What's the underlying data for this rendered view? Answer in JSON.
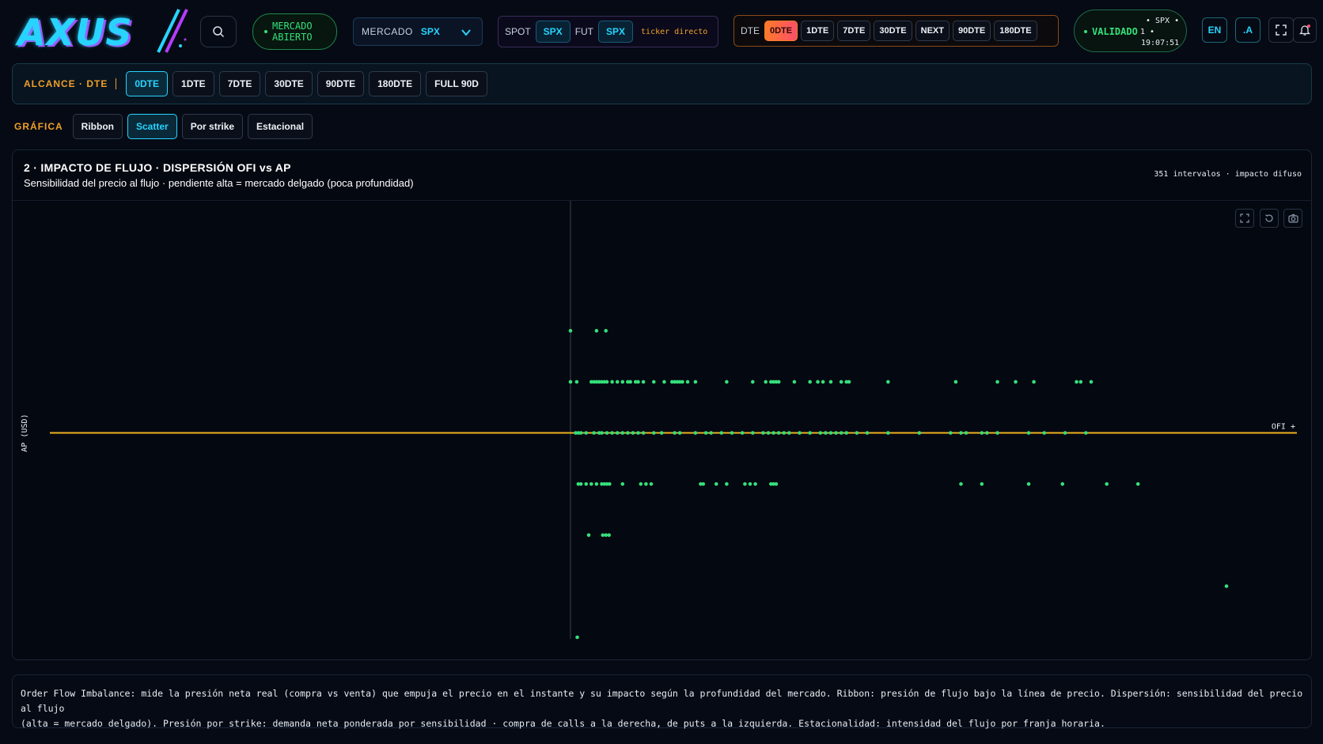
{
  "brand": {
    "name": "AXUS"
  },
  "market_status": {
    "line1": "MERCADO",
    "line2": "ABIERTO"
  },
  "mercado": {
    "label": "MERCADO",
    "value": "SPX"
  },
  "ticker": {
    "spot_label": "SPOT",
    "spot_value": "SPX",
    "fut_label": "FUT",
    "fut_value": "SPX",
    "note": "ticker directo"
  },
  "dte_bar": {
    "label": "DTE",
    "items": [
      "0DTE",
      "1DTE",
      "7DTE",
      "30DTE",
      "NEXT",
      "90DTE",
      "180DTE"
    ],
    "active": "0DTE"
  },
  "validation": {
    "status": "VALIDADO",
    "symbol": "• SPX •",
    "count": "1 •",
    "time": "19:07:51"
  },
  "lang": {
    "label": "EN"
  },
  "font_toggle": {
    "label": ".A"
  },
  "alcance": {
    "label": "ALCANCE · DTE",
    "items": [
      "0DTE",
      "1DTE",
      "7DTE",
      "30DTE",
      "90DTE",
      "180DTE",
      "FULL 90D"
    ],
    "active": "0DTE"
  },
  "grafica": {
    "label": "GRÁFICA",
    "items": [
      "Ribbon",
      "Scatter",
      "Por strike",
      "Estacional"
    ],
    "active": "Scatter"
  },
  "panel": {
    "title": "2 · IMPACTO DE FLUJO · DISPERSIÓN OFI vs AP",
    "subtitle": "Sensibilidad del precio al flujo · pendiente alta = mercado delgado (poca profundidad)",
    "meta": "351 intervalos · impacto difuso"
  },
  "colors": {
    "accent_cyan": "#28d4ff",
    "accent_orange": "#f0a028",
    "positive_green": "#35e07a",
    "zero_line": "#f0b020"
  },
  "chart_data": {
    "type": "scatter",
    "title": "2 · IMPACTO DE FLUJO · DISPERSIÓN OFI vs AP",
    "xlabel": "",
    "ylabel": "AP (USD)",
    "zero_line_label": "OFI +",
    "xlim": [
      -1,
      1
    ],
    "ylim": [
      -4,
      4
    ],
    "grid": false,
    "series": [
      {
        "points": [
          [
            0.0,
            2
          ],
          [
            0.05,
            2
          ],
          [
            0.068,
            2
          ],
          [
            0.0,
            1
          ],
          [
            0.012,
            1
          ],
          [
            0.04,
            1
          ],
          [
            0.045,
            1
          ],
          [
            0.05,
            1
          ],
          [
            0.055,
            1
          ],
          [
            0.06,
            1
          ],
          [
            0.065,
            1
          ],
          [
            0.07,
            1
          ],
          [
            0.08,
            1
          ],
          [
            0.09,
            1
          ],
          [
            0.1,
            1
          ],
          [
            0.11,
            1
          ],
          [
            0.115,
            1
          ],
          [
            0.125,
            1
          ],
          [
            0.13,
            1
          ],
          [
            0.14,
            1
          ],
          [
            0.16,
            1
          ],
          [
            0.18,
            1
          ],
          [
            0.195,
            1
          ],
          [
            0.2,
            1
          ],
          [
            0.205,
            1
          ],
          [
            0.21,
            1
          ],
          [
            0.215,
            1
          ],
          [
            0.225,
            1
          ],
          [
            0.24,
            1
          ],
          [
            0.3,
            1
          ],
          [
            0.35,
            1
          ],
          [
            0.375,
            1
          ],
          [
            0.385,
            1
          ],
          [
            0.39,
            1
          ],
          [
            0.395,
            1
          ],
          [
            0.4,
            1
          ],
          [
            0.43,
            1
          ],
          [
            0.46,
            1
          ],
          [
            0.475,
            1
          ],
          [
            0.485,
            1
          ],
          [
            0.5,
            1
          ],
          [
            0.52,
            1
          ],
          [
            0.53,
            1
          ],
          [
            0.535,
            1
          ],
          [
            0.61,
            1
          ],
          [
            0.74,
            1
          ],
          [
            0.82,
            1
          ],
          [
            0.855,
            1
          ],
          [
            0.89,
            1
          ],
          [
            0.972,
            1
          ],
          [
            0.98,
            1
          ],
          [
            1.0,
            1
          ],
          [
            0.01,
            0
          ],
          [
            0.015,
            0
          ],
          [
            0.02,
            0
          ],
          [
            0.03,
            0
          ],
          [
            0.045,
            0
          ],
          [
            0.055,
            0
          ],
          [
            0.06,
            0
          ],
          [
            0.07,
            0
          ],
          [
            0.08,
            0
          ],
          [
            0.09,
            0
          ],
          [
            0.1,
            0
          ],
          [
            0.11,
            0
          ],
          [
            0.12,
            0
          ],
          [
            0.13,
            0
          ],
          [
            0.14,
            0
          ],
          [
            0.16,
            0
          ],
          [
            0.175,
            0
          ],
          [
            0.2,
            0
          ],
          [
            0.21,
            0
          ],
          [
            0.24,
            0
          ],
          [
            0.26,
            0
          ],
          [
            0.27,
            0
          ],
          [
            0.29,
            0
          ],
          [
            0.31,
            0
          ],
          [
            0.33,
            0
          ],
          [
            0.35,
            0
          ],
          [
            0.37,
            0
          ],
          [
            0.38,
            0
          ],
          [
            0.39,
            0
          ],
          [
            0.4,
            0
          ],
          [
            0.41,
            0
          ],
          [
            0.42,
            0
          ],
          [
            0.44,
            0
          ],
          [
            0.46,
            0
          ],
          [
            0.48,
            0
          ],
          [
            0.49,
            0
          ],
          [
            0.5,
            0
          ],
          [
            0.51,
            0
          ],
          [
            0.52,
            0
          ],
          [
            0.53,
            0
          ],
          [
            0.55,
            0
          ],
          [
            0.57,
            0
          ],
          [
            0.61,
            0
          ],
          [
            0.67,
            0
          ],
          [
            0.73,
            0
          ],
          [
            0.75,
            0
          ],
          [
            0.76,
            0
          ],
          [
            0.79,
            0
          ],
          [
            0.8,
            0
          ],
          [
            0.82,
            0
          ],
          [
            0.88,
            0
          ],
          [
            0.91,
            0
          ],
          [
            0.95,
            0
          ],
          [
            0.99,
            0
          ],
          [
            0.015,
            -1
          ],
          [
            0.02,
            -1
          ],
          [
            0.03,
            -1
          ],
          [
            0.04,
            -1
          ],
          [
            0.05,
            -1
          ],
          [
            0.06,
            -1
          ],
          [
            0.065,
            -1
          ],
          [
            0.07,
            -1
          ],
          [
            0.075,
            -1
          ],
          [
            0.1,
            -1
          ],
          [
            0.135,
            -1
          ],
          [
            0.145,
            -1
          ],
          [
            0.155,
            -1
          ],
          [
            0.25,
            -1
          ],
          [
            0.255,
            -1
          ],
          [
            0.28,
            -1
          ],
          [
            0.3,
            -1
          ],
          [
            0.335,
            -1
          ],
          [
            0.345,
            -1
          ],
          [
            0.355,
            -1
          ],
          [
            0.385,
            -1
          ],
          [
            0.39,
            -1
          ],
          [
            0.395,
            -1
          ],
          [
            0.75,
            -1
          ],
          [
            0.79,
            -1
          ],
          [
            0.88,
            -1
          ],
          [
            0.945,
            -1
          ],
          [
            1.03,
            -1
          ],
          [
            1.09,
            -1
          ],
          [
            0.035,
            -2
          ],
          [
            0.062,
            -2
          ],
          [
            0.068,
            -2
          ],
          [
            0.074,
            -2
          ],
          [
            1.26,
            -3
          ],
          [
            0.013,
            -4
          ]
        ]
      }
    ]
  },
  "footer": {
    "line1": "Order Flow Imbalance: mide la presión neta real (compra vs venta) que empuja el precio en el instante y su impacto según la profundidad del mercado. Ribbon: presión de flujo bajo la línea de precio. Dispersión: sensibilidad del precio al flujo",
    "line2": "(alta = mercado delgado). Presión por strike: demanda neta ponderada por sensibilidad · compra de calls a la derecha, de puts a la izquierda. Estacionalidad: intensidad del flujo por franja horaria."
  }
}
